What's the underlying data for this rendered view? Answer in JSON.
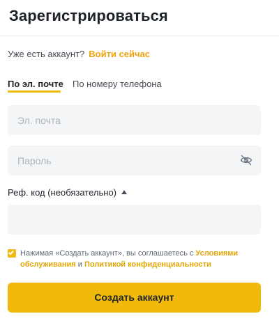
{
  "page": {
    "title": "Зарегистрироваться"
  },
  "login": {
    "prompt": "Уже есть аккаунт?",
    "link": "Войти сейчас"
  },
  "tabs": [
    {
      "label": "По эл. почте",
      "active": true
    },
    {
      "label": "По номеру телефона",
      "active": false
    }
  ],
  "form": {
    "email_placeholder": "Эл. почта",
    "password_placeholder": "Пароль",
    "password_toggle_icon": "eye-off-icon",
    "ref_label": "Реф. код (необязательно)",
    "ref_toggle_icon": "caret-up-icon",
    "ref_placeholder": ""
  },
  "agreement": {
    "checked": true,
    "text_before": "Нажимая «Создать аккаунт», вы соглашаетесь с ",
    "terms_link": "Условиями обслуживания",
    "conjunction": " и ",
    "privacy_link": "Политикой конфиденциальности"
  },
  "submit": {
    "label": "Создать аккаунт"
  },
  "colors": {
    "accent": "#f0b90b",
    "link": "#f0a20b",
    "input_bg": "#f4f5f7",
    "text": "#1e2329"
  }
}
